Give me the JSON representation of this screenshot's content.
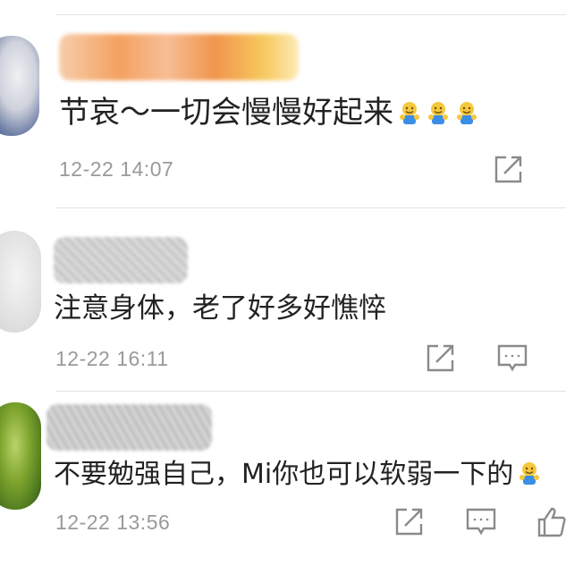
{
  "comments": [
    {
      "text": "节哀～一切会慢慢好起来",
      "emoji_icons": [
        "hug-emoji",
        "hug-emoji",
        "hug-emoji"
      ],
      "time": "12-22 14:07",
      "actions": [
        "share-icon"
      ]
    },
    {
      "text": "注意身体，老了好多好憔悴",
      "time": "12-22 16:11",
      "actions": [
        "share-icon",
        "comment-icon"
      ]
    },
    {
      "text": "不要勉强自己，Mi你也可以软弱一下的",
      "emoji_icons": [
        "hug-emoji"
      ],
      "time": "12-22 13:56",
      "actions": [
        "share-icon",
        "comment-icon",
        "like-icon"
      ]
    }
  ],
  "colors": {
    "text": "#222222",
    "timestamp": "#9a9a9a",
    "icon": "#8a8a8a",
    "divider": "#e2e2e2"
  }
}
